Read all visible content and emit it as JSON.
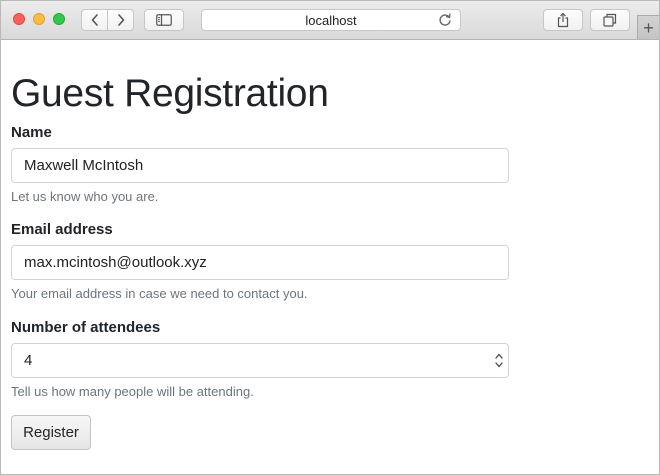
{
  "browser": {
    "address": "localhost",
    "icons": {
      "back": "chevron-left-icon",
      "forward": "chevron-right-icon",
      "sidebar": "sidebar-icon",
      "reload": "reload-icon",
      "share": "share-icon",
      "tabs": "tabs-icon",
      "new_tab": "plus-icon"
    },
    "new_tab_glyph": "+"
  },
  "page": {
    "title": "Guest Registration"
  },
  "form": {
    "name": {
      "label": "Name",
      "value": "Maxwell McIntosh",
      "help": "Let us know who you are."
    },
    "email": {
      "label": "Email address",
      "value": "max.mcintosh@outlook.xyz",
      "help": "Your email address in case we need to contact you."
    },
    "attendees": {
      "label": "Number of attendees",
      "value": "4",
      "help": "Tell us how many people will be attending."
    },
    "submit_label": "Register"
  },
  "colors": {
    "traffic_red": "#fc605b",
    "traffic_yellow": "#fdbc40",
    "traffic_green": "#34c84a",
    "text": "#212529",
    "help_text": "#6c757d",
    "input_border": "#ced4da"
  }
}
